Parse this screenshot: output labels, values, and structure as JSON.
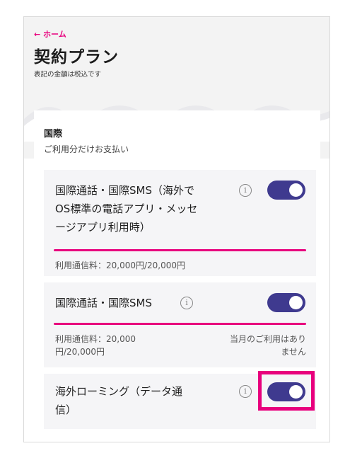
{
  "header": {
    "back_label": "← ホーム",
    "title": "契約プラン",
    "tax_note": "表記の金額は税込です"
  },
  "section": {
    "title": "国際",
    "subtitle": "ご利用分だけお支払い"
  },
  "items": [
    {
      "label_lines": [
        "国際通話・国際SMS（海外で",
        "OS標準の電話アプリ・メッセ",
        "ージアプリ利用時）"
      ],
      "enabled": true,
      "usage_fraction": 1.0,
      "fee": "利用通信料：20,000円/20,000円"
    },
    {
      "label_lines": [
        "国際通話・国際SMS"
      ],
      "enabled": true,
      "usage_fraction": 1.0,
      "fee_lines": [
        "利用通信料：20,000",
        "円/20,000円"
      ],
      "status_lines": [
        "当月のご利用はあり",
        "ません"
      ]
    },
    {
      "label_lines": [
        "海外ローミング（データ通",
        "信）"
      ],
      "enabled": true,
      "highlighted": true
    }
  ],
  "icons": {
    "info": "info-icon",
    "back": "arrow-left-icon"
  },
  "colors": {
    "accent": "#e8007d",
    "toggle_on": "#3f3a8f",
    "item_bg": "#f5f5f7"
  }
}
